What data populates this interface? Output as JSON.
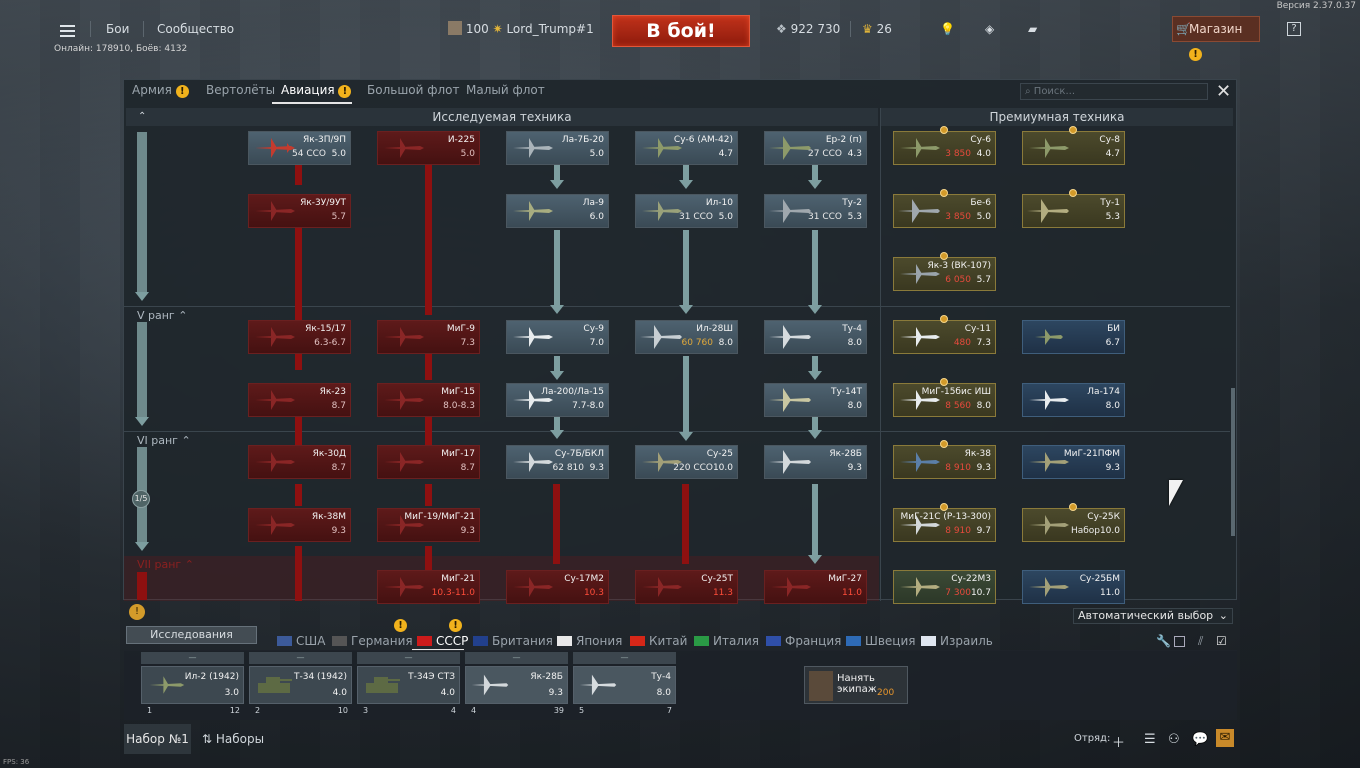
{
  "version": "Версия 2.37.0.37",
  "topbar": {
    "battles": "Бои",
    "community": "Сообщество",
    "level": "100",
    "nickname": "Lord_Trump#1",
    "battle_button": "В бой!",
    "silver": "922 730",
    "gold": "26",
    "shop": "Магазин"
  },
  "online": "Онлайн: 178910, Боёв: 4132",
  "tabs": [
    {
      "label": "Армия"
    },
    {
      "label": "Вертолёты"
    },
    {
      "label": "Авиация"
    },
    {
      "label": "Большой флот"
    },
    {
      "label": "Малый флот"
    }
  ],
  "search_placeholder": "Поиск...",
  "headers": {
    "research": "Исследуемая техника",
    "premium": "Премиумная техника"
  },
  "ranks": {
    "v": "V ранг",
    "vi": "VI ранг",
    "vii": "VII ранг"
  },
  "page_indicator": "1/5",
  "cards": {
    "yak3p": {
      "name": "Як-3П/9П",
      "cost": "54 CCO",
      "br": "5.0"
    },
    "i225": {
      "name": "И-225",
      "br": "5.0"
    },
    "la7b20": {
      "name": "Ла-7Б-20",
      "br": "5.0"
    },
    "su6am42": {
      "name": "Су-6 (АМ-42)",
      "br": "4.7"
    },
    "er2": {
      "name": "Ер-2 (п)",
      "cost": "27 CCO",
      "br": "4.3"
    },
    "yak3u": {
      "name": "Як-3У/9УТ",
      "br": "5.7"
    },
    "la9": {
      "name": "Ла-9",
      "br": "6.0"
    },
    "il10": {
      "name": "Ил-10",
      "cost": "31 CCO",
      "br": "5.0"
    },
    "tu2": {
      "name": "Ту-2",
      "cost": "31 CCO",
      "br": "5.3"
    },
    "yak15": {
      "name": "Як-15/17",
      "br": "6.3-6.7"
    },
    "mig9": {
      "name": "МиГ-9",
      "br": "7.3"
    },
    "su9": {
      "name": "Су-9",
      "br": "7.0"
    },
    "il28sh": {
      "name": "Ил-28Ш",
      "cost": "60 760",
      "br": "8.0"
    },
    "tu4": {
      "name": "Ту-4",
      "br": "8.0"
    },
    "yak23": {
      "name": "Як-23",
      "br": "8.7"
    },
    "mig15": {
      "name": "МиГ-15",
      "br": "8.0-8.3"
    },
    "la200": {
      "name": "Ла-200/Ла-15",
      "br": "7.7-8.0"
    },
    "tu14t": {
      "name": "Ту-14Т",
      "br": "8.0"
    },
    "yak30d": {
      "name": "Як-30Д",
      "br": "8.7"
    },
    "mig17": {
      "name": "МиГ-17",
      "br": "8.7"
    },
    "su7b": {
      "name": "Су-7Б/БКЛ",
      "cost": "62 810",
      "br": "9.3"
    },
    "su25": {
      "name": "Су-25",
      "cost": "220 CCO",
      "br": "10.0"
    },
    "yak28b": {
      "name": "Як-28Б",
      "br": "9.3"
    },
    "yak38m": {
      "name": "Як-38М",
      "br": "9.3"
    },
    "mig19": {
      "name": "МиГ-19/МиГ-21",
      "br": "9.3"
    },
    "mig21": {
      "name": "МиГ-21",
      "br": "10.3-11.0"
    },
    "su17m2": {
      "name": "Су-17М2",
      "br": "10.3"
    },
    "su25t": {
      "name": "Су-25Т",
      "br": "11.3"
    },
    "mig27": {
      "name": "МиГ-27",
      "br": "11.0"
    },
    "p_su6": {
      "name": "Су-6",
      "cost": "3 850",
      "br": "4.0"
    },
    "p_su8": {
      "name": "Су-8",
      "br": "4.7"
    },
    "p_be6": {
      "name": "Бе-6",
      "cost": "3 850",
      "br": "5.0"
    },
    "p_tu1": {
      "name": "Ту-1",
      "br": "5.3"
    },
    "p_yak3vk": {
      "name": "Як-3 (ВК-107)",
      "cost": "6 050",
      "br": "5.7"
    },
    "p_su11": {
      "name": "Су-11",
      "cost": "480",
      "br": "7.3"
    },
    "p_bi": {
      "name": "БИ",
      "br": "6.7"
    },
    "p_mig15bis": {
      "name": "МиГ-15бис ИШ",
      "cost": "8 560",
      "br": "8.0"
    },
    "p_la174": {
      "name": "Ла-174",
      "br": "8.0"
    },
    "p_yak38": {
      "name": "Як-38",
      "cost": "8 910",
      "br": "9.3"
    },
    "p_mig21pfm": {
      "name": "МиГ-21ПФМ",
      "br": "9.3"
    },
    "p_mig21s": {
      "name": "МиГ-21С (Р-13-300)",
      "cost": "8 910",
      "br": "9.7"
    },
    "p_su25k": {
      "name": "Су-25К",
      "cost": "Набор",
      "br": "10.0"
    },
    "p_su22m3": {
      "name": "Су-22М3",
      "cost": "7 300",
      "br": "10.7"
    },
    "p_su25bm": {
      "name": "Су-25БМ",
      "br": "11.0"
    }
  },
  "auto_select": "Автоматический выбор",
  "research_button": "Исследования",
  "nations": [
    {
      "label": "США",
      "c": "#3c5a99"
    },
    {
      "label": "Германия",
      "c": "#555"
    },
    {
      "label": "СССР",
      "c": "#cc1b1b"
    },
    {
      "label": "Британия",
      "c": "#22408c"
    },
    {
      "label": "Япония",
      "c": "#e9e9e9"
    },
    {
      "label": "Китай",
      "c": "#d62718"
    },
    {
      "label": "Италия",
      "c": "#2a9a45"
    },
    {
      "label": "Франция",
      "c": "#2f4fa8"
    },
    {
      "label": "Швеция",
      "c": "#2e6bb5"
    },
    {
      "label": "Израиль",
      "c": "#dfe6ef"
    }
  ],
  "crews": [
    {
      "dash": "—",
      "name": "Ил-2 (1942)",
      "br": "3.0",
      "num": "1",
      "lvl": "12"
    },
    {
      "dash": "—",
      "name": "Т-34 (1942)",
      "br": "4.0",
      "num": "2",
      "lvl": "10"
    },
    {
      "dash": "—",
      "name": "Т-34Э СТЗ",
      "br": "4.0",
      "num": "3",
      "lvl": "4"
    },
    {
      "dash": "—",
      "name": "Як-28Б",
      "br": "9.3",
      "num": "4",
      "lvl": "39"
    },
    {
      "dash": "—",
      "name": "Ту-4",
      "br": "8.0",
      "num": "5",
      "lvl": "7"
    }
  ],
  "hire": {
    "label": "Нанять экипаж",
    "cost": "200"
  },
  "bottombar": {
    "preset": "Набор №1",
    "presets": "Наборы",
    "squad": "Отряд:"
  },
  "fps": "FPS: 36"
}
